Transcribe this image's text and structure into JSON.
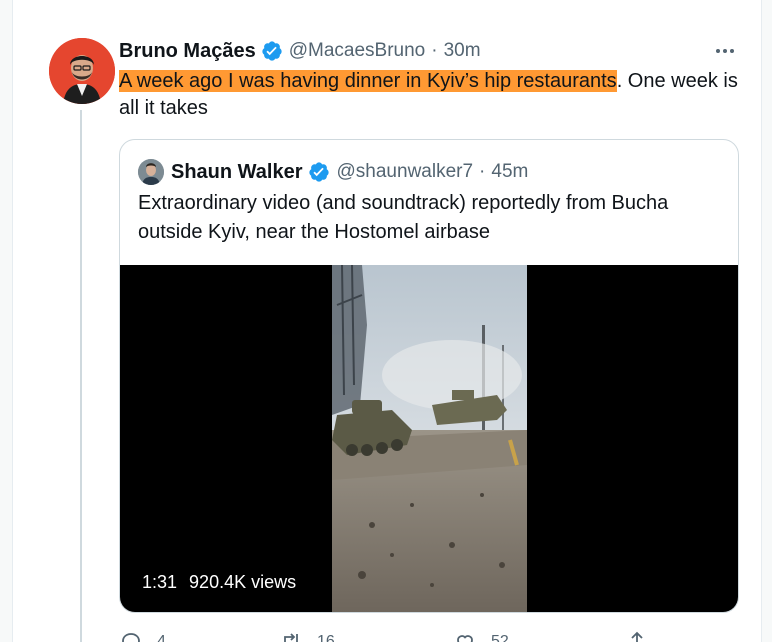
{
  "tweet": {
    "author_name": "Bruno Maçães",
    "author_handle": "@MacaesBruno",
    "separator": "·",
    "time": "30m",
    "text_highlighted": "A week ago I was having dinner in Kyiv’s hip restaurants",
    "text_rest": ". One week is all it takes",
    "colors": {
      "highlight": "#ff9933",
      "verified": "#1d9bf0",
      "avatar_bg": "#e5462f"
    }
  },
  "quote": {
    "author_name": "Shaun Walker",
    "author_handle": "@shaunwalker7",
    "separator": "·",
    "time": "45m",
    "text": "Extraordinary video (and soundtrack) reportedly from Bucha outside Kyiv, near the Hostomel airbase",
    "video": {
      "duration": "1:31",
      "views": "920.4K views"
    }
  },
  "actions": {
    "reply_count": "4",
    "retweet_count": "16",
    "like_count": "52"
  },
  "icons": [
    "verified-badge-icon",
    "more-options-icon",
    "reply-icon",
    "retweet-icon",
    "like-icon",
    "share-icon"
  ]
}
